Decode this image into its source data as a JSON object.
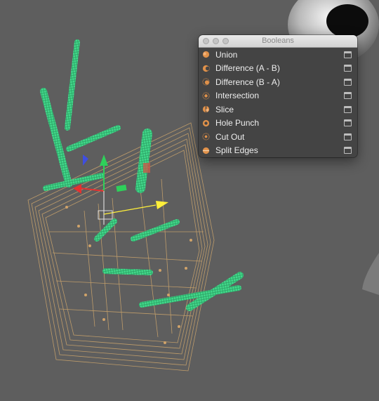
{
  "panel": {
    "title": "Booleans",
    "items": [
      {
        "label": "Union",
        "icon": "union-icon"
      },
      {
        "label": "Difference (A - B)",
        "icon": "difference-a-b-icon"
      },
      {
        "label": "Difference (B - A)",
        "icon": "difference-b-a-icon"
      },
      {
        "label": "Intersection",
        "icon": "intersection-icon"
      },
      {
        "label": "Slice",
        "icon": "slice-icon"
      },
      {
        "label": "Hole Punch",
        "icon": "hole-punch-icon"
      },
      {
        "label": "Cut Out",
        "icon": "cut-out-icon"
      },
      {
        "label": "Split Edges",
        "icon": "split-edges-icon"
      }
    ]
  },
  "colors": {
    "viewport_background": "#5e5e5e",
    "cylinder_wireframe": "#4fe89a",
    "frame_wireframe": "#c9a36c",
    "menu_background": "#444444",
    "menu_icon": "#e0914a",
    "gizmo_x": "#e53030",
    "gizmo_y": "#2ed05a",
    "gizmo_z": "#3f4ee0",
    "light_gizmo": "#ffef3a"
  }
}
